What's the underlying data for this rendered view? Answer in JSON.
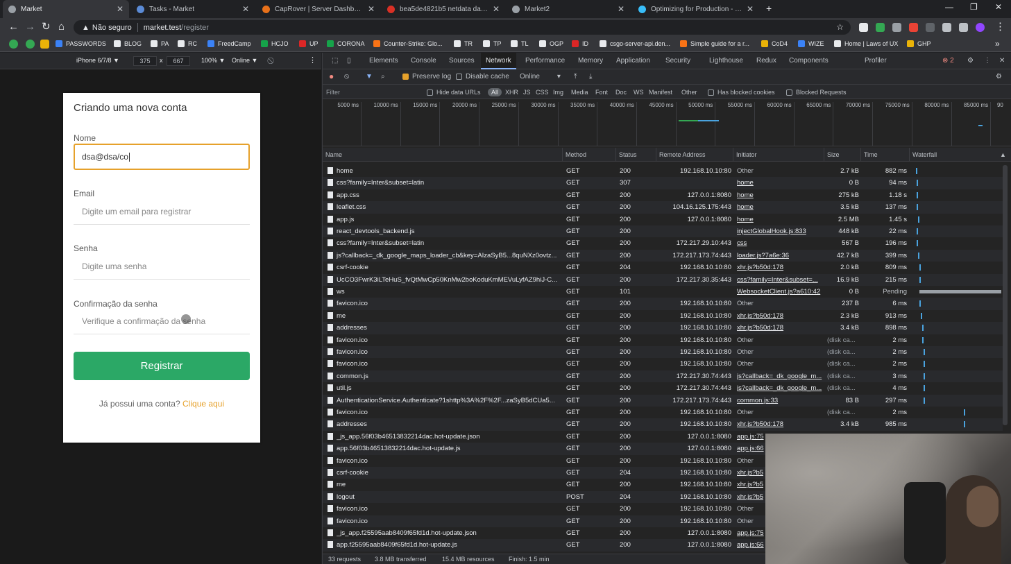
{
  "browser": {
    "tabs": [
      {
        "label": "Market",
        "active": true,
        "color": "#9aa0a6"
      },
      {
        "label": "Tasks - Market",
        "active": false,
        "color": "#5b8bd6"
      },
      {
        "label": "CapRover | Server Dashboard",
        "active": false,
        "color": "#e8711a"
      },
      {
        "label": "bea5de4821b5 netdata dashboa",
        "active": false,
        "color": "#d93025"
      },
      {
        "label": "Market2",
        "active": false,
        "color": "#9aa0a6"
      },
      {
        "label": "Optimizing for Production - Tailw",
        "active": false,
        "color": "#38bdf8"
      }
    ],
    "new_tab": "+",
    "window_controls": {
      "minimize": "—",
      "maximize": "❐",
      "close": "✕"
    },
    "address": {
      "security": "Não seguro",
      "host": "market.test",
      "path": "/register"
    },
    "bookmarks": [
      {
        "label": "PASSWORDS",
        "color": "#3b82f6"
      },
      {
        "label": "BLOG",
        "color": "#e8eaed"
      },
      {
        "label": "PA",
        "color": "#e8eaed"
      },
      {
        "label": "RC",
        "color": "#e8eaed"
      },
      {
        "label": "FreedCamp",
        "color": "#3b82f6"
      },
      {
        "label": "HCJO",
        "color": "#16a34a"
      },
      {
        "label": "UP",
        "color": "#dc2626"
      },
      {
        "label": "CORONA",
        "color": "#16a34a"
      },
      {
        "label": "Counter-Strike: Glo...",
        "color": "#f97316"
      },
      {
        "label": "TR",
        "color": "#e8eaed"
      },
      {
        "label": "TP",
        "color": "#e8eaed"
      },
      {
        "label": "TL",
        "color": "#e8eaed"
      },
      {
        "label": "OGP",
        "color": "#e8eaed"
      },
      {
        "label": "ID",
        "color": "#dc2626"
      },
      {
        "label": "csgo-server-api.den...",
        "color": "#e8eaed"
      },
      {
        "label": "Simple guide for a r...",
        "color": "#f97316"
      },
      {
        "label": "CoD4",
        "color": "#eab308"
      },
      {
        "label": "WIZE",
        "color": "#3b82f6"
      },
      {
        "label": "Home | Laws of UX",
        "color": "#e8eaed"
      },
      {
        "label": "GHP",
        "color": "#eab308"
      }
    ],
    "bookmarks_more": "»"
  },
  "device_toolbar": {
    "device": "iPhone 6/7/8 ▼",
    "width": "375",
    "times": "x",
    "height": "667",
    "zoom": "100% ▼",
    "throttle": "Online ▼"
  },
  "page": {
    "title": "Criando uma nova conta",
    "name_label": "Nome",
    "name_value": "dsa@dsa/co",
    "email_label": "Email",
    "email_placeholder": "Digite um email para registrar",
    "password_label": "Senha",
    "password_placeholder": "Digite uma senha",
    "confirm_label": "Confirmação da senha",
    "confirm_placeholder": "Verifique a confirmação da senha",
    "register_button": "Registrar",
    "login_prompt": "Já possui uma conta?",
    "login_link": "Clique aqui"
  },
  "devtools": {
    "tabs": [
      "Elements",
      "Console",
      "Sources",
      "Network",
      "Performance",
      "Memory",
      "Application",
      "Security",
      "Lighthouse",
      "Redux",
      "Components",
      "Profiler"
    ],
    "active_tab": "Network",
    "error_count": "2",
    "toolbar": {
      "preserve_log": "Preserve log",
      "disable_cache": "Disable cache",
      "throttle": "Online"
    },
    "filter": {
      "placeholder": "Filter",
      "hide_data_urls": "Hide data URLs",
      "types": [
        "All",
        "XHR",
        "JS",
        "CSS",
        "Img",
        "Media",
        "Font",
        "Doc",
        "WS",
        "Manifest",
        "Other"
      ],
      "blocked_cookies": "Has blocked cookies",
      "blocked_requests": "Blocked Requests"
    },
    "timeline_ticks": [
      "5000 ms",
      "10000 ms",
      "15000 ms",
      "20000 ms",
      "25000 ms",
      "30000 ms",
      "35000 ms",
      "40000 ms",
      "45000 ms",
      "50000 ms",
      "55000 ms",
      "60000 ms",
      "65000 ms",
      "70000 ms",
      "75000 ms",
      "80000 ms",
      "85000 ms",
      "90"
    ],
    "columns": {
      "name": "Name",
      "method": "Method",
      "status": "Status",
      "remote": "Remote Address",
      "initiator": "Initiator",
      "size": "Size",
      "time": "Time",
      "waterfall": "Waterfall"
    },
    "requests": [
      {
        "name": "home",
        "method": "GET",
        "status": "200",
        "remote": "192.168.10.10:80",
        "initiator": "Other",
        "link": false,
        "size": "2.7 kB",
        "time": "882 ms"
      },
      {
        "name": "css?family=Inter&subset=latin",
        "method": "GET",
        "status": "307",
        "remote": "",
        "initiator": "home",
        "link": true,
        "size": "0 B",
        "time": "94 ms"
      },
      {
        "name": "app.css",
        "method": "GET",
        "status": "200",
        "remote": "127.0.0.1:8080",
        "initiator": "home",
        "link": true,
        "size": "275 kB",
        "time": "1.18 s"
      },
      {
        "name": "leaflet.css",
        "method": "GET",
        "status": "200",
        "remote": "104.16.125.175:443",
        "initiator": "home",
        "link": true,
        "size": "3.5 kB",
        "time": "137 ms"
      },
      {
        "name": "app.js",
        "method": "GET",
        "status": "200",
        "remote": "127.0.0.1:8080",
        "initiator": "home",
        "link": true,
        "size": "2.5 MB",
        "time": "1.45 s"
      },
      {
        "name": "react_devtools_backend.js",
        "method": "GET",
        "status": "200",
        "remote": "",
        "initiator": "injectGlobalHook.js:833",
        "link": true,
        "size": "448 kB",
        "time": "22 ms"
      },
      {
        "name": "css?family=Inter&subset=latin",
        "method": "GET",
        "status": "200",
        "remote": "172.217.29.10:443",
        "initiator": "css",
        "link": true,
        "size": "567 B",
        "time": "196 ms"
      },
      {
        "name": "js?callback=_dk_google_maps_loader_cb&key=AIzaSyB5...8quNXz0ovtz...",
        "method": "GET",
        "status": "200",
        "remote": "172.217.173.74:443",
        "initiator": "loader.js?7a6e:36",
        "link": true,
        "size": "42.7 kB",
        "time": "399 ms"
      },
      {
        "name": "csrf-cookie",
        "method": "GET",
        "status": "204",
        "remote": "192.168.10.10:80",
        "initiator": "xhr.js?b50d:178",
        "link": true,
        "size": "2.0 kB",
        "time": "809 ms"
      },
      {
        "name": "UcCO3FwrK3iLTeHuS_fvQtMwCp50KnMw2boKoduKmMEVuLyfAZ9hiJ-C...",
        "method": "GET",
        "status": "200",
        "remote": "172.217.30.35:443",
        "initiator": "css?family=Inter&subset=...",
        "link": true,
        "size": "16.9 kB",
        "time": "215 ms"
      },
      {
        "name": "ws",
        "method": "GET",
        "status": "101",
        "remote": "",
        "initiator": "WebsocketClient.js?a610:42",
        "link": true,
        "size": "0 B",
        "time": "Pending"
      },
      {
        "name": "favicon.ico",
        "method": "GET",
        "status": "200",
        "remote": "192.168.10.10:80",
        "initiator": "Other",
        "link": false,
        "size": "237 B",
        "time": "6 ms"
      },
      {
        "name": "me",
        "method": "GET",
        "status": "200",
        "remote": "192.168.10.10:80",
        "initiator": "xhr.js?b50d:178",
        "link": true,
        "size": "2.3 kB",
        "time": "913 ms"
      },
      {
        "name": "addresses",
        "method": "GET",
        "status": "200",
        "remote": "192.168.10.10:80",
        "initiator": "xhr.js?b50d:178",
        "link": true,
        "size": "3.4 kB",
        "time": "898 ms"
      },
      {
        "name": "favicon.ico",
        "method": "GET",
        "status": "200",
        "remote": "192.168.10.10:80",
        "initiator": "Other",
        "link": false,
        "size": "(disk ca...",
        "time": "2 ms"
      },
      {
        "name": "favicon.ico",
        "method": "GET",
        "status": "200",
        "remote": "192.168.10.10:80",
        "initiator": "Other",
        "link": false,
        "size": "(disk ca...",
        "time": "2 ms"
      },
      {
        "name": "favicon.ico",
        "method": "GET",
        "status": "200",
        "remote": "192.168.10.10:80",
        "initiator": "Other",
        "link": false,
        "size": "(disk ca...",
        "time": "2 ms"
      },
      {
        "name": "common.js",
        "method": "GET",
        "status": "200",
        "remote": "172.217.30.74:443",
        "initiator": "js?callback=_dk_google_m...",
        "link": true,
        "size": "(disk ca...",
        "time": "3 ms"
      },
      {
        "name": "util.js",
        "method": "GET",
        "status": "200",
        "remote": "172.217.30.74:443",
        "initiator": "js?callback=_dk_google_m...",
        "link": true,
        "size": "(disk ca...",
        "time": "4 ms"
      },
      {
        "name": "AuthenticationService.Authenticate?1shttp%3A%2F%2F...zaSyB5dCUa5...",
        "method": "GET",
        "status": "200",
        "remote": "172.217.173.74:443",
        "initiator": "common.js:33",
        "link": true,
        "size": "83 B",
        "time": "297 ms"
      },
      {
        "name": "favicon.ico",
        "method": "GET",
        "status": "200",
        "remote": "192.168.10.10:80",
        "initiator": "Other",
        "link": false,
        "size": "(disk ca...",
        "time": "2 ms"
      },
      {
        "name": "addresses",
        "method": "GET",
        "status": "200",
        "remote": "192.168.10.10:80",
        "initiator": "xhr.js?b50d:178",
        "link": true,
        "size": "3.4 kB",
        "time": "985 ms"
      },
      {
        "name": "_js_app.56f03b46513832214dac.hot-update.json",
        "method": "GET",
        "status": "200",
        "remote": "127.0.0.1:8080",
        "initiator": "app.js:75",
        "link": true,
        "size": "",
        "time": ""
      },
      {
        "name": "app.56f03b46513832214dac.hot-update.js",
        "method": "GET",
        "status": "200",
        "remote": "127.0.0.1:8080",
        "initiator": "app.js:66",
        "link": true,
        "size": "",
        "time": ""
      },
      {
        "name": "favicon.ico",
        "method": "GET",
        "status": "200",
        "remote": "192.168.10.10:80",
        "initiator": "Other",
        "link": false,
        "size": "",
        "time": ""
      },
      {
        "name": "csrf-cookie",
        "method": "GET",
        "status": "204",
        "remote": "192.168.10.10:80",
        "initiator": "xhr.js?b5",
        "link": true,
        "size": "",
        "time": ""
      },
      {
        "name": "me",
        "method": "GET",
        "status": "200",
        "remote": "192.168.10.10:80",
        "initiator": "xhr.js?b5",
        "link": true,
        "size": "",
        "time": ""
      },
      {
        "name": "logout",
        "method": "POST",
        "status": "204",
        "remote": "192.168.10.10:80",
        "initiator": "xhr.js?b5",
        "link": true,
        "size": "",
        "time": ""
      },
      {
        "name": "favicon.ico",
        "method": "GET",
        "status": "200",
        "remote": "192.168.10.10:80",
        "initiator": "Other",
        "link": false,
        "size": "",
        "time": ""
      },
      {
        "name": "favicon.ico",
        "method": "GET",
        "status": "200",
        "remote": "192.168.10.10:80",
        "initiator": "Other",
        "link": false,
        "size": "",
        "time": ""
      },
      {
        "name": "_js_app.f25595aab8409f65fd1d.hot-update.json",
        "method": "GET",
        "status": "200",
        "remote": "127.0.0.1:8080",
        "initiator": "app.js:75",
        "link": true,
        "size": "",
        "time": ""
      },
      {
        "name": "app.f25595aab8409f65fd1d.hot-update.js",
        "method": "GET",
        "status": "200",
        "remote": "127.0.0.1:8080",
        "initiator": "app.js:66",
        "link": true,
        "size": "",
        "time": ""
      }
    ],
    "status": {
      "requests": "33 requests",
      "transferred": "3.8 MB transferred",
      "resources": "15.4 MB resources",
      "finish": "Finish: 1.5 min"
    }
  },
  "colors": {
    "accent_orange": "#e6a12b",
    "register_green": "#2ba866",
    "link_blue": "#8ab4f8"
  }
}
